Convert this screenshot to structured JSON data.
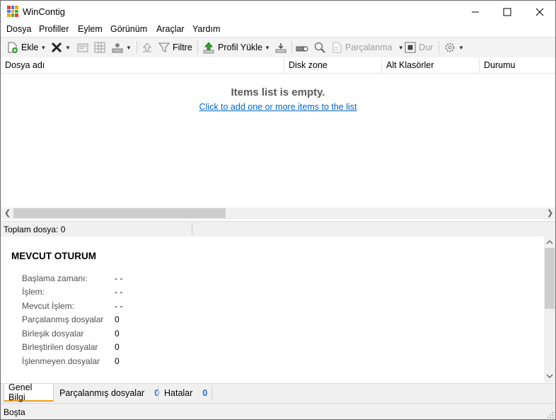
{
  "window": {
    "title": "WinContig"
  },
  "menu": [
    "Dosya",
    "Profiller",
    "Eylem",
    "Görünüm",
    "Araçlar",
    "Yardım"
  ],
  "toolbar": {
    "add_label": "Ekle",
    "filter_label": "Filtre",
    "load_profile_label": "Profil Yükle",
    "defrag_label": "Parçalanma",
    "stop_label": "Dur"
  },
  "columns": [
    "Dosya adı",
    "Disk zone",
    "Alt Klasörler",
    "Durumu"
  ],
  "empty_state": {
    "title": "Items list is empty.",
    "link": "Click to add one or more items to the list"
  },
  "file_count": "Toplam dosya: 0",
  "session": {
    "title": "MEVCUT OTURUM",
    "rows": [
      {
        "label": "Başlama zamanı:",
        "value": "- -"
      },
      {
        "label": "İşlem:",
        "value": "- -"
      },
      {
        "label": "Mevcut İşlem:",
        "value": "- -"
      },
      {
        "label": "Parçalanmış dosyalar",
        "value": "0"
      },
      {
        "label": "Birleşik dosyalar",
        "value": "0"
      },
      {
        "label": "Birleştirilen dosyalar",
        "value": "0"
      },
      {
        "label": "İşlenmeyen dosyalar",
        "value": "0"
      }
    ]
  },
  "tabs": [
    {
      "label": "Genel Bilgi"
    },
    {
      "label": "Parçalanmış dosyalar",
      "count": "0"
    },
    {
      "label": "Hatalar",
      "count": "0"
    }
  ],
  "status": "Boşta",
  "colors": {
    "link": "#0066cc",
    "tab_count": "#1e6fd6",
    "active_tab_accent": "#f0a020"
  }
}
